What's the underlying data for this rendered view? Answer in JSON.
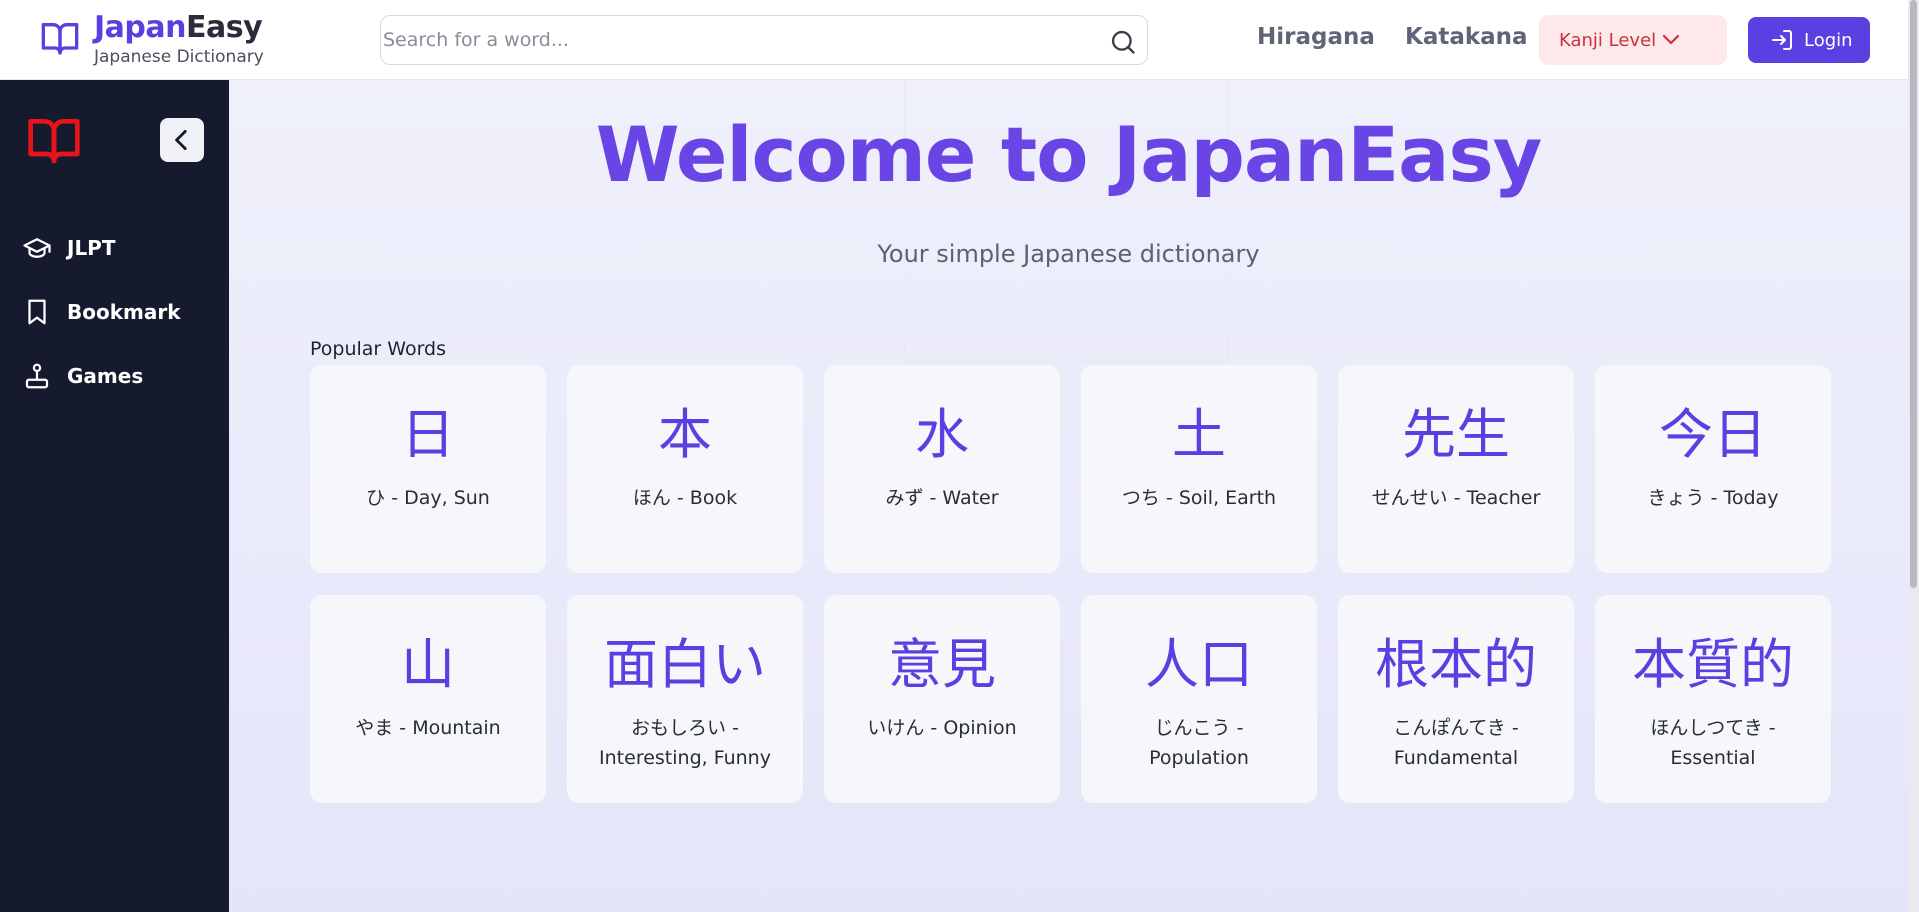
{
  "header": {
    "brand_part1": "Japan",
    "brand_part2": "Easy",
    "subtitle": "Japanese Dictionary",
    "search_placeholder": "Search for a word...",
    "nav": [
      "Hiragana",
      "Katakana"
    ],
    "kanji_level_label": "Kanji Level",
    "login_label": "Login"
  },
  "sidebar": {
    "items": [
      {
        "label": "JLPT",
        "icon": "graduation-cap-icon"
      },
      {
        "label": "Bookmark",
        "icon": "bookmark-icon"
      },
      {
        "label": "Games",
        "icon": "joystick-icon"
      }
    ]
  },
  "main": {
    "title": "Welcome to JapanEasy",
    "tagline": "Your simple Japanese dictionary",
    "popular_title": "Popular Words",
    "words": [
      {
        "kanji": "日",
        "meaning": "ひ - Day, Sun"
      },
      {
        "kanji": "本",
        "meaning": "ほん - Book"
      },
      {
        "kanji": "水",
        "meaning": "みず - Water"
      },
      {
        "kanji": "土",
        "meaning": "つち - Soil, Earth"
      },
      {
        "kanji": "先生",
        "meaning": "せんせい - Teacher"
      },
      {
        "kanji": "今日",
        "meaning": "きょう - Today"
      },
      {
        "kanji": "山",
        "meaning": "やま - Mountain"
      },
      {
        "kanji": "面白い",
        "meaning": "おもしろい - Interesting, Funny"
      },
      {
        "kanji": "意見",
        "meaning": "いけん - Opinion"
      },
      {
        "kanji": "人口",
        "meaning": "じんこう - Population"
      },
      {
        "kanji": "根本的",
        "meaning": "こんぽんてき - Fundamental"
      },
      {
        "kanji": "本質的",
        "meaning": "ほんしつてき - Essential"
      }
    ]
  },
  "colors": {
    "accent": "#5b3fe0",
    "sidebar_bg": "#161a2e",
    "kanji_btn_bg": "#fde9ea",
    "kanji_btn_text": "#c9323d",
    "sidebar_logo": "#e8141b"
  }
}
